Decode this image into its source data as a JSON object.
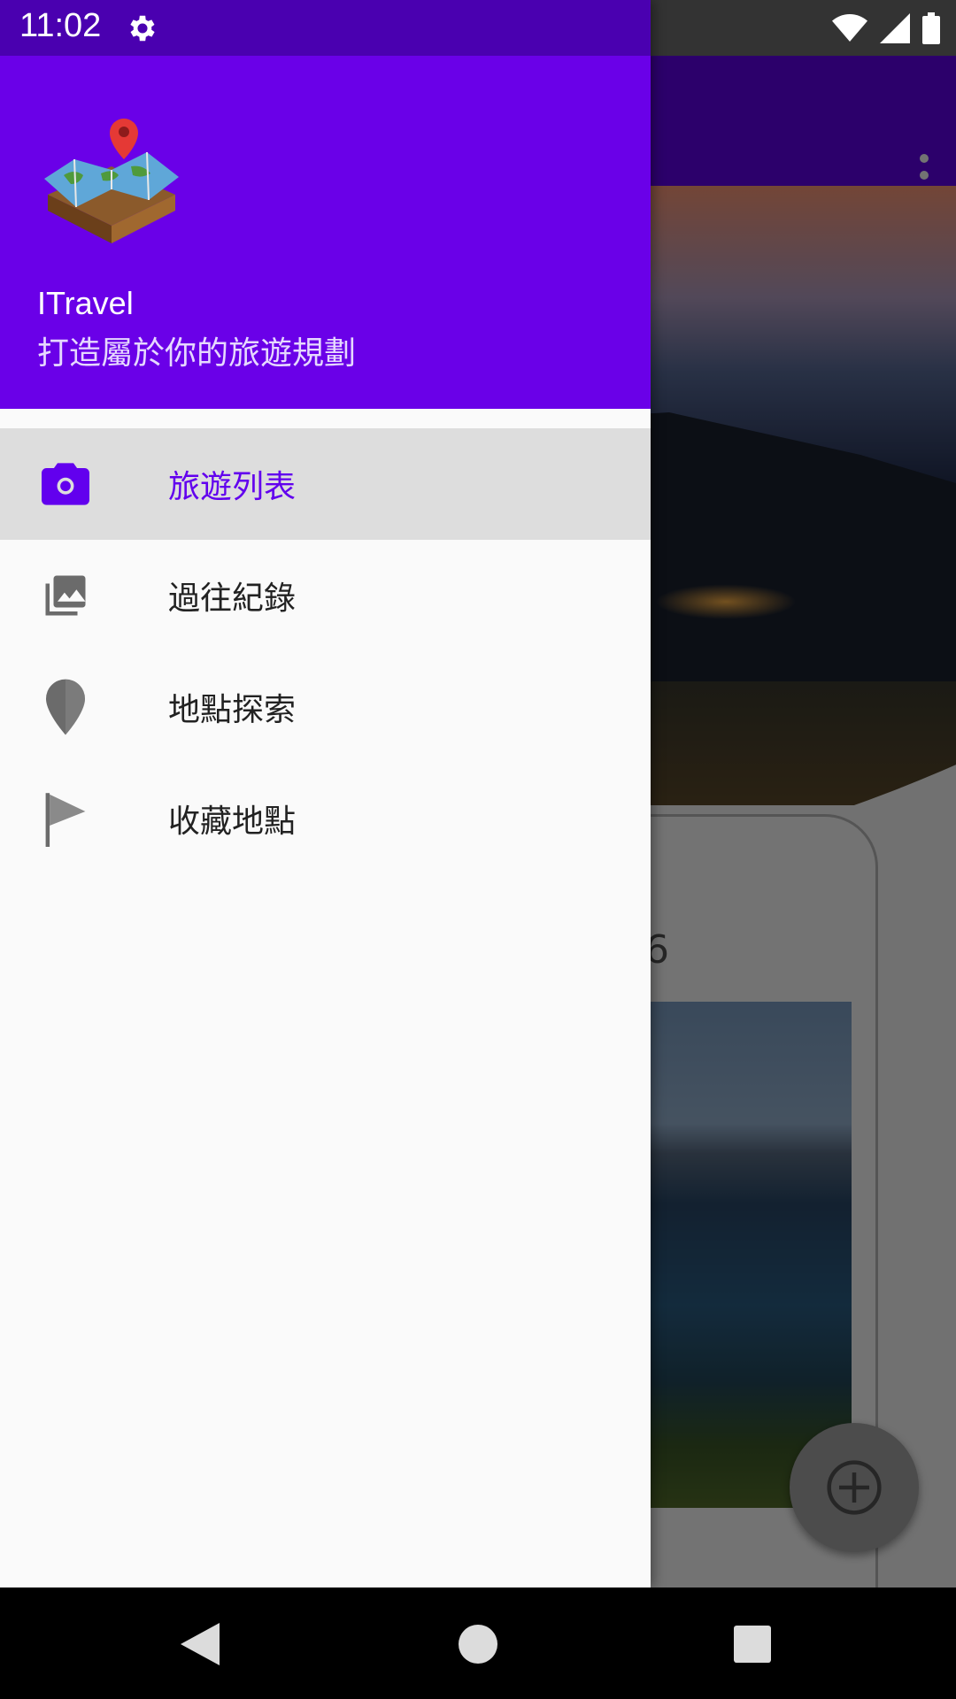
{
  "status_bar": {
    "time": "11:02",
    "icons": [
      "settings-icon",
      "wifi-icon",
      "signal-icon",
      "battery-icon"
    ]
  },
  "drawer": {
    "header": {
      "title": "ITravel",
      "subtitle": "打造屬於你的旅遊規劃",
      "logo": "map-pin-logo"
    },
    "items": [
      {
        "label": "旅遊列表",
        "icon": "camera-icon",
        "active": true
      },
      {
        "label": "過往紀錄",
        "icon": "photo-library-icon",
        "active": false
      },
      {
        "label": "地點探索",
        "icon": "place-icon",
        "active": false
      },
      {
        "label": "收藏地點",
        "icon": "flag-icon",
        "active": false
      }
    ]
  },
  "background_app": {
    "card_partial_text": "6",
    "fab_icon": "add-circle-icon"
  },
  "colors": {
    "primary": "#6200ee",
    "header": "#6a00e8",
    "active_item_bg": "#dddddd"
  },
  "nav_bar": {
    "buttons": [
      "back-icon",
      "home-icon",
      "recents-icon"
    ]
  }
}
